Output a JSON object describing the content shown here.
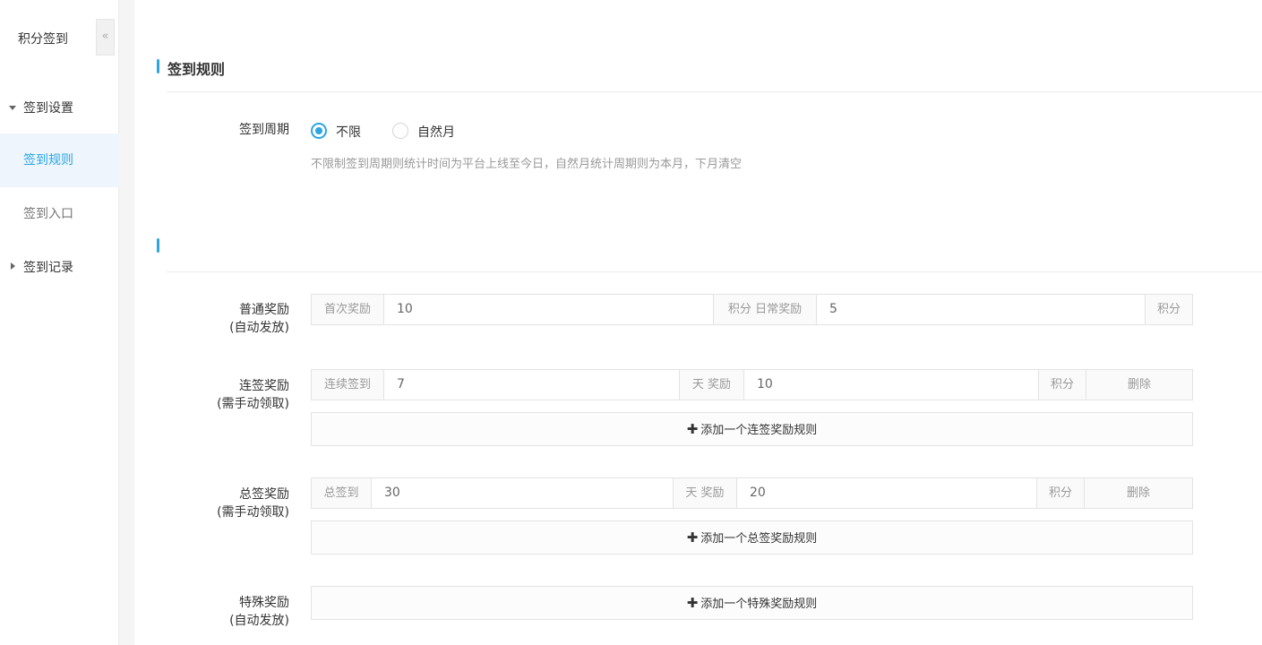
{
  "sidebar": {
    "title": "积分签到",
    "collapse_icon": "«",
    "groups": [
      {
        "label": "签到设置",
        "expanded": true,
        "items": [
          {
            "label": "签到规则",
            "active": true
          },
          {
            "label": "签到入口",
            "active": false
          }
        ]
      },
      {
        "label": "签到记录",
        "expanded": false
      }
    ]
  },
  "main": {
    "section1_title": "签到规则",
    "cycle": {
      "label": "签到周期",
      "options": [
        "不限",
        "自然月"
      ],
      "selected": "不限",
      "hint": "不限制签到周期则统计时间为平台上线至今日，自然月统计周期则为本月，下月清空"
    },
    "section2_title": "",
    "normal": {
      "label_line1": "普通奖励",
      "label_line2": "(自动发放)",
      "first_label": "首次奖励",
      "first_value": "10",
      "unit1": "积分",
      "daily_label": "日常奖励",
      "daily_value": "5",
      "unit2": "积分"
    },
    "streak": {
      "label_line1": "连签奖励",
      "label_line2": "(需手动领取)",
      "prefix": "连续签到",
      "days_value": "7",
      "mid": "天 奖励",
      "reward_value": "10",
      "unit": "积分",
      "delete_label": "删除",
      "add_label": "添加一个连签奖励规则"
    },
    "total": {
      "label_line1": "总签奖励",
      "label_line2": "(需手动领取)",
      "prefix": "总签到",
      "days_value": "30",
      "mid": "天 奖励",
      "reward_value": "20",
      "unit": "积分",
      "delete_label": "删除",
      "add_label": "添加一个总签奖励规则"
    },
    "special": {
      "label_line1": "特殊奖励",
      "label_line2": "(自动发放)",
      "add_label": "添加一个特殊奖励规则"
    },
    "plus_icon": "✚"
  }
}
